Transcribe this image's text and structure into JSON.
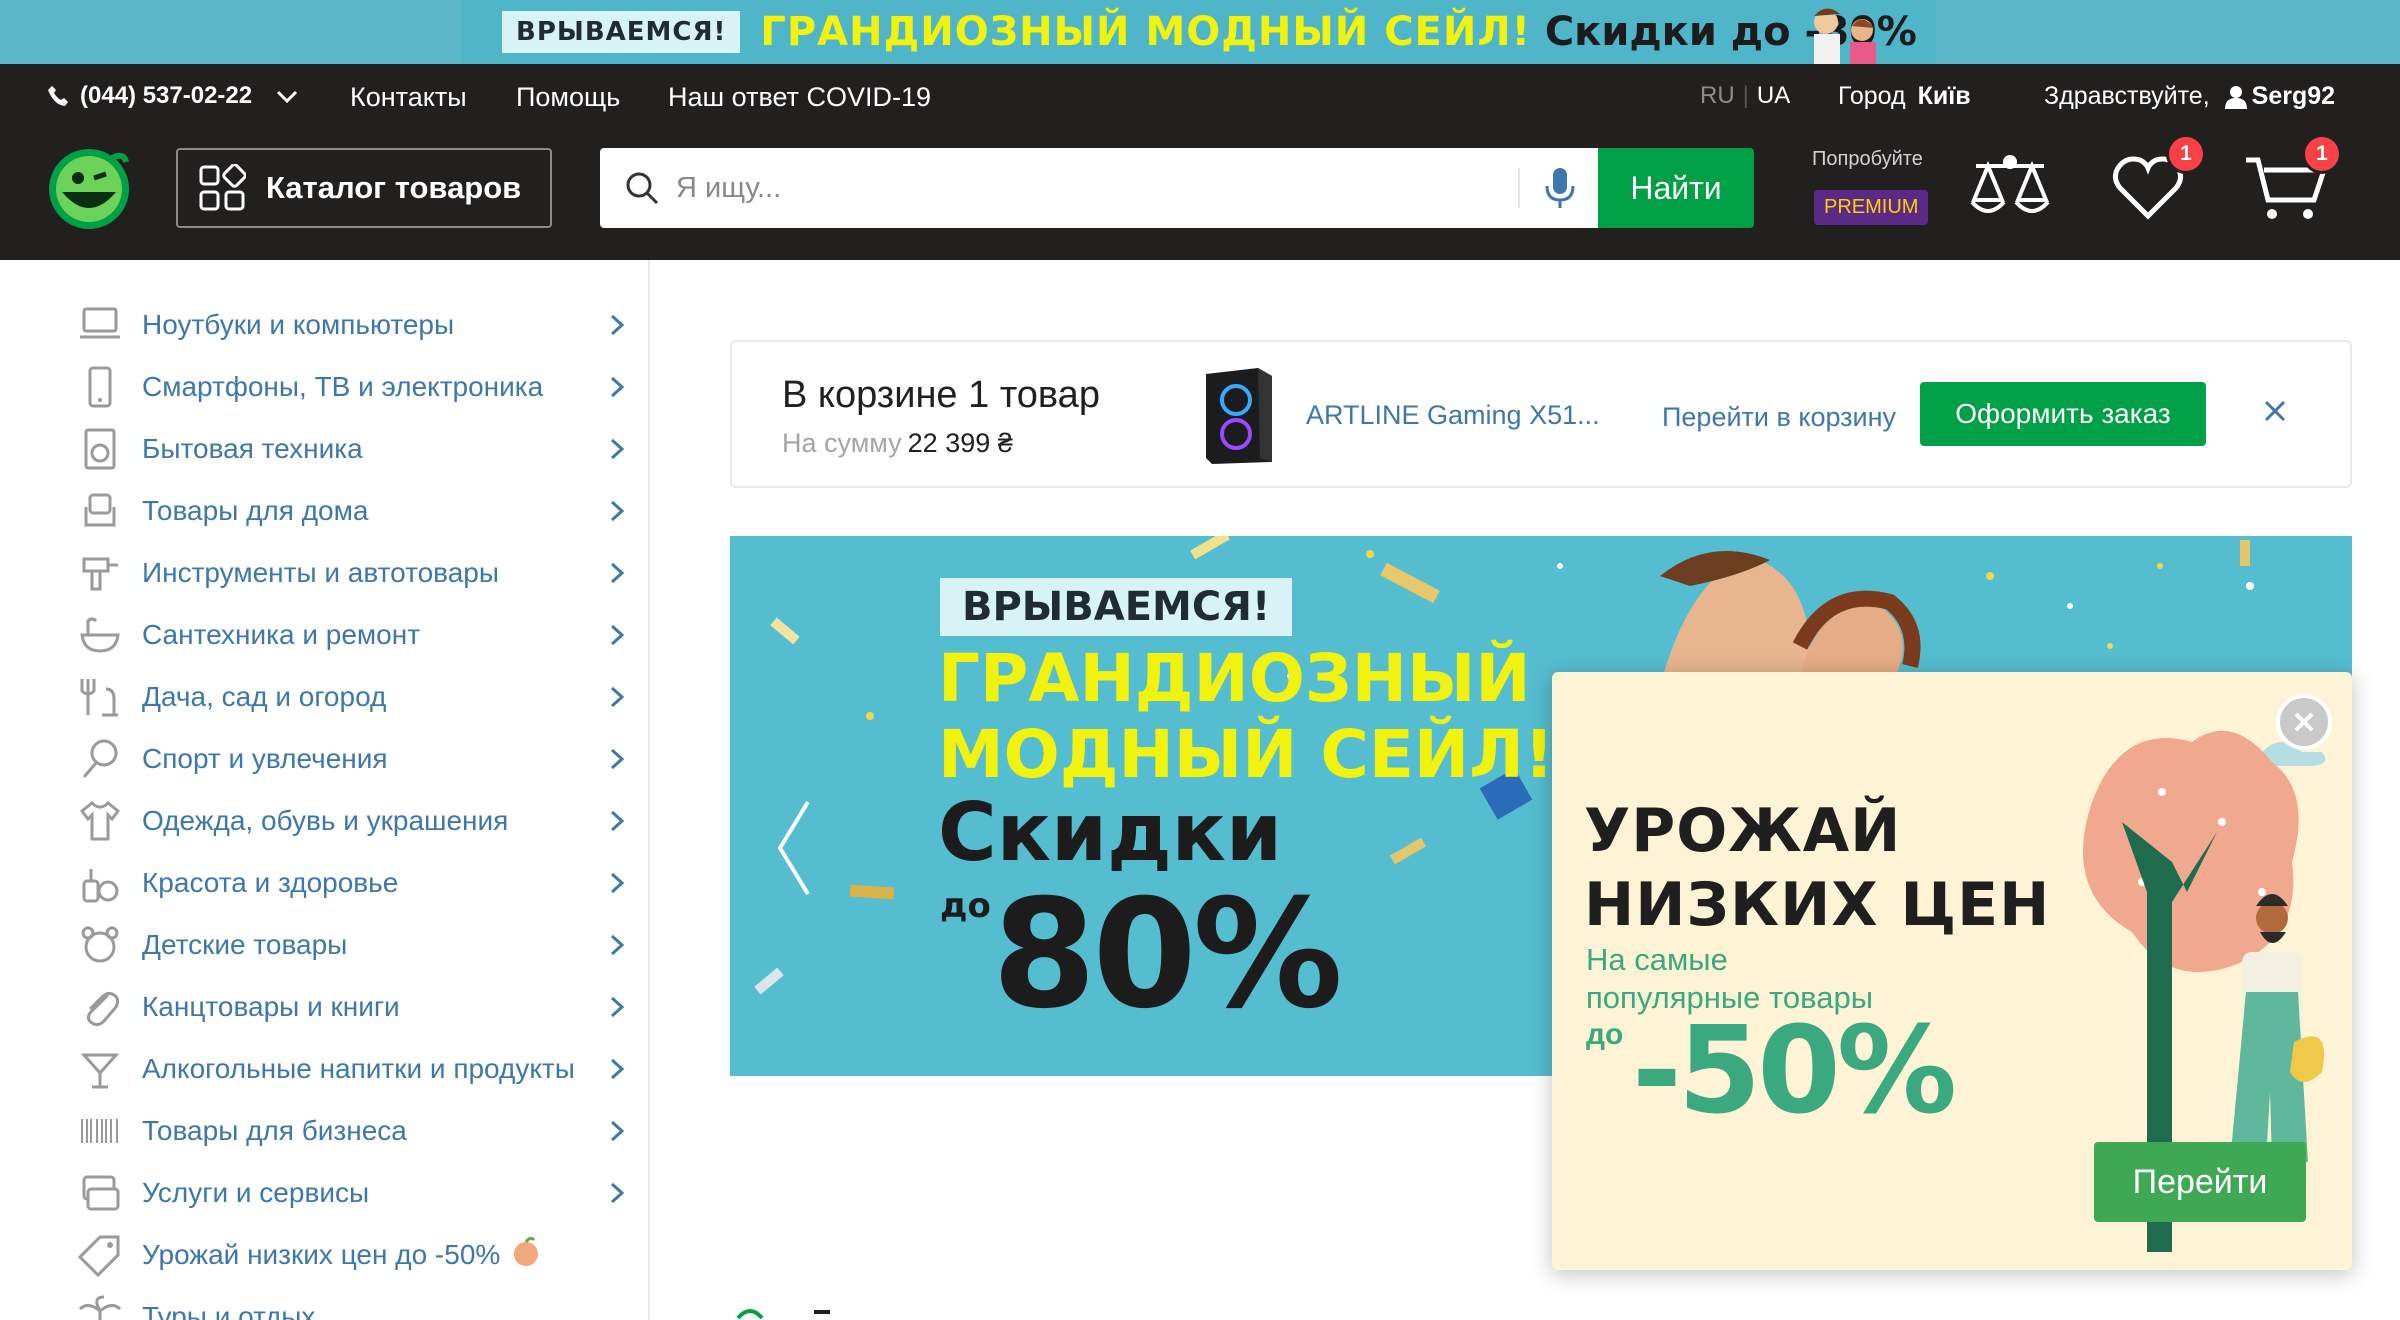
{
  "promo": {
    "tag": "ВРЫВАЕМСЯ!",
    "sale": "ГРАНДИОЗНЫЙ МОДНЫЙ СЕЙЛ!",
    "discount": "Скидки до -80%"
  },
  "header": {
    "phone": "(044) 537-02-22",
    "nav": [
      "Контакты",
      "Помощь",
      "Наш ответ COVID-19"
    ],
    "lang_ru": "RU",
    "lang_ua": "UA",
    "city_label": "Город",
    "city": "Київ",
    "greeting": "Здравствуйте,",
    "user": "Serg92",
    "catalog": "Каталог товаров",
    "search_placeholder": "Я ищу...",
    "search_button": "Найти",
    "premium_try": "Попробуйте",
    "premium": "PREMIUM",
    "wishlist_count": "1",
    "cart_count": "1"
  },
  "sidebar": {
    "items": [
      {
        "label": "Ноутбуки и компьютеры",
        "icon": "laptop-icon"
      },
      {
        "label": "Смартфоны, ТВ и электроника",
        "icon": "phone-icon"
      },
      {
        "label": "Бытовая техника",
        "icon": "washer-icon"
      },
      {
        "label": "Товары для дома",
        "icon": "armchair-icon"
      },
      {
        "label": "Инструменты и автотовары",
        "icon": "drill-icon"
      },
      {
        "label": "Сантехника и ремонт",
        "icon": "bathtub-icon"
      },
      {
        "label": "Дача, сад и огород",
        "icon": "garden-icon"
      },
      {
        "label": "Спорт и увлечения",
        "icon": "racket-icon"
      },
      {
        "label": "Одежда, обувь и украшения",
        "icon": "tshirt-icon"
      },
      {
        "label": "Красота и здоровье",
        "icon": "cosmetics-icon"
      },
      {
        "label": "Детские товары",
        "icon": "bear-icon"
      },
      {
        "label": "Канцтовары и книги",
        "icon": "paperclip-icon"
      },
      {
        "label": "Алкогольные напитки и продукты",
        "icon": "cocktail-icon"
      },
      {
        "label": "Товары для бизнеса",
        "icon": "barcode-icon"
      },
      {
        "label": "Услуги и сервисы",
        "icon": "services-icon"
      },
      {
        "label": "Урожай низких цен до -50%",
        "icon": "tag-icon"
      },
      {
        "label": "Туры и отдых",
        "icon": "palm-icon"
      }
    ]
  },
  "cart_notice": {
    "title": "В корзине 1 товар",
    "sum_label": "На сумму",
    "sum": "22 399 ₴",
    "product": "ARTLINE Gaming X51...",
    "goto": "Перейти в корзину",
    "order": "Оформить заказ"
  },
  "banner": {
    "tag": "ВРЫВАЕМСЯ!",
    "line1": "ГРАНДИОЗНЫЙ",
    "line2": "МОДНЫЙ СЕЙЛ!",
    "line3": "Скидки",
    "do": "до",
    "percent": "80%"
  },
  "popup": {
    "title1": "УРОЖАЙ",
    "title2": "НИЗКИХ ЦЕН",
    "sub1": "На самые",
    "sub2": "популярные товары",
    "do": "до",
    "percent": "-50%",
    "button": "Перейти"
  },
  "colors": {
    "header_bg": "#221f1f",
    "accent_green": "#00a046",
    "link_blue": "#3e77aa",
    "badge_red": "#f84147",
    "banner_bg": "#55bdd0",
    "popup_bg": "#fff3d6"
  }
}
